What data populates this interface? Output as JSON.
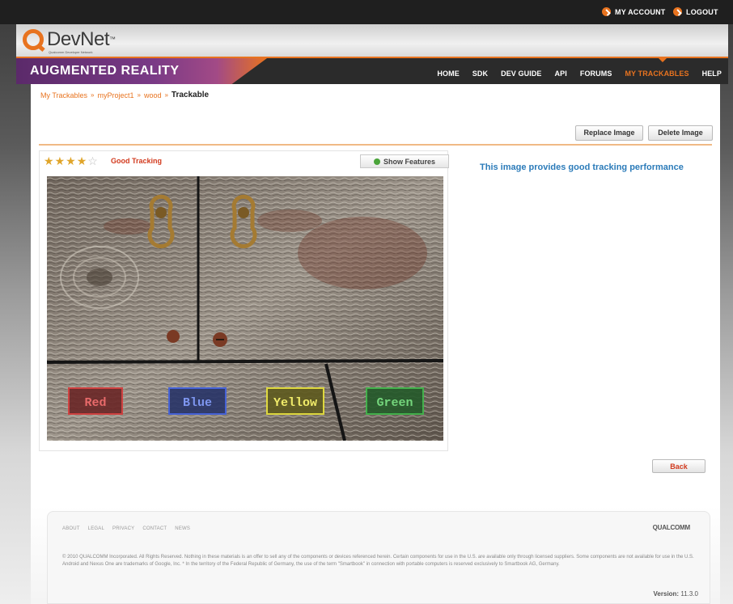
{
  "top": {
    "my_account": "MY ACCOUNT",
    "logout": "LOGOUT"
  },
  "logo": {
    "brand": "DevNet",
    "tm": "™",
    "subtitle": "Qualcomm Developer Network"
  },
  "banner": {
    "title": "AUGMENTED REALITY"
  },
  "nav": {
    "items": [
      {
        "label": "HOME"
      },
      {
        "label": "SDK"
      },
      {
        "label": "DEV GUIDE"
      },
      {
        "label": "API"
      },
      {
        "label": "FORUMS"
      },
      {
        "label": "MY TRACKABLES"
      },
      {
        "label": "HELP"
      }
    ],
    "active": "MY TRACKABLES"
  },
  "breadcrumb": {
    "items": [
      "My Trackables",
      "myProject1",
      "wood"
    ],
    "sep": "»",
    "current": "Trackable"
  },
  "actions": {
    "replace": "Replace Image",
    "delete": "Delete Image"
  },
  "rating": {
    "stars_filled": 4,
    "stars_total": 5,
    "label": "Good Tracking"
  },
  "features_button": "Show Features",
  "image": {
    "labels": [
      "Red",
      "Blue",
      "Yellow",
      "Green"
    ],
    "label_colors": [
      "#d53a3a",
      "#3f5fe0",
      "#e8e23a",
      "#3fb84a"
    ]
  },
  "info_text": "This image provides good tracking performance",
  "back_button": "Back",
  "footer": {
    "links": [
      "ABOUT",
      "LEGAL",
      "PRIVACY",
      "CONTACT",
      "NEWS"
    ],
    "brand": "QUALCOMM",
    "legal": "© 2010 QUALCOMM Incorporated. All Rights Reserved. Nothing in these materials is an offer to sell any of the components or devices referenced herein. Certain components for use in the U.S. are available only through licensed suppliers. Some components are not available for use in the U.S. Android and Nexus One are trademarks of Google, Inc. * In the territory of the Federal Republic of Germany, the use of the term \"Smartbook\" in connection with portable computers is reserved exclusively to Smartbook AG, Germany.",
    "version_label": "Version:",
    "version_value": "11.3.0"
  },
  "colors": {
    "accent": "#e8731f",
    "link_blue": "#2b7bb9",
    "alert_red": "#d23a1e"
  }
}
